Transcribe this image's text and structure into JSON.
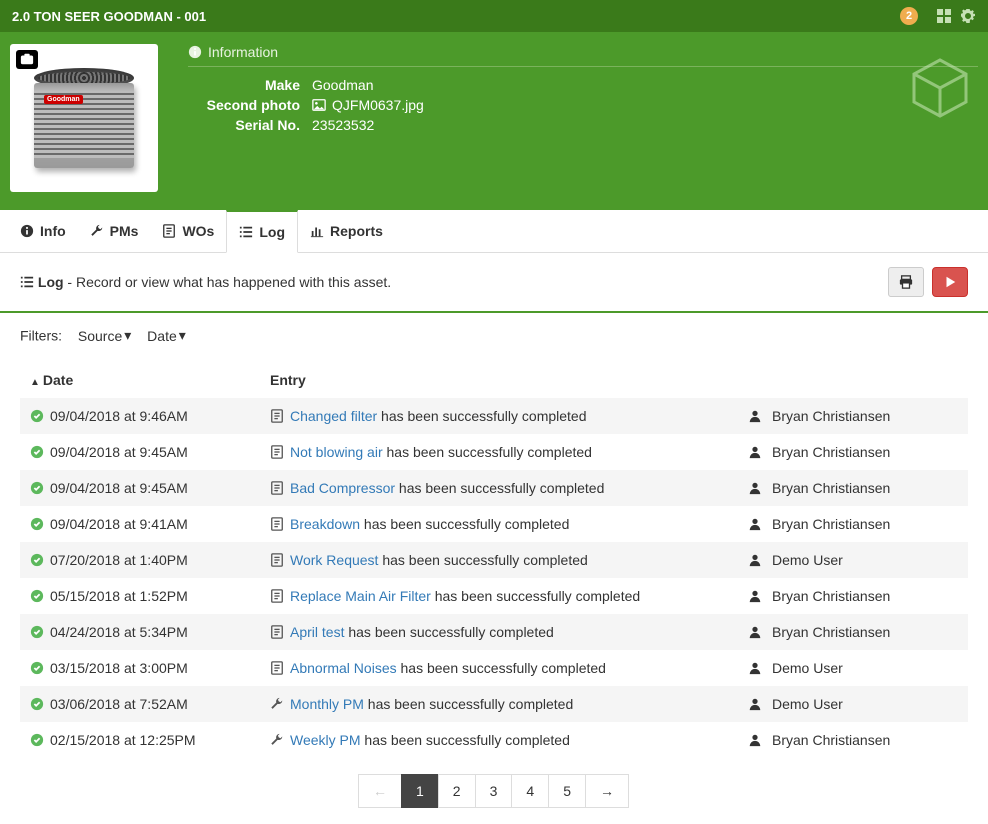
{
  "header": {
    "title": "2.0 TON SEER GOODMAN - 001",
    "notification_count": "2"
  },
  "info": {
    "heading": "Information",
    "make_label": "Make",
    "make_value": "Goodman",
    "photo_label": "Second photo",
    "photo_value": "QJFM0637.jpg",
    "serial_label": "Serial No.",
    "serial_value": "23523532",
    "brand_tag": "Goodman"
  },
  "tabs": {
    "info": "Info",
    "pms": "PMs",
    "wos": "WOs",
    "log": "Log",
    "reports": "Reports"
  },
  "subheader": {
    "title": "Log",
    "desc": " - Record or view what has happened with this asset."
  },
  "filters": {
    "label": "Filters:",
    "source": "Source",
    "date": "Date"
  },
  "columns": {
    "date": "Date",
    "entry": "Entry",
    "user": ""
  },
  "entry_suffix": " has been successfully completed",
  "rows": [
    {
      "date": "09/04/2018 at 9:46AM",
      "icon": "form",
      "link": "Changed filter",
      "user": "Bryan Christiansen"
    },
    {
      "date": "09/04/2018 at 9:45AM",
      "icon": "form",
      "link": "Not blowing air",
      "user": "Bryan Christiansen"
    },
    {
      "date": "09/04/2018 at 9:45AM",
      "icon": "form",
      "link": "Bad Compressor",
      "user": "Bryan Christiansen"
    },
    {
      "date": "09/04/2018 at 9:41AM",
      "icon": "form",
      "link": "Breakdown",
      "user": "Bryan Christiansen"
    },
    {
      "date": "07/20/2018 at 1:40PM",
      "icon": "form",
      "link": "Work Request",
      "user": "Demo User"
    },
    {
      "date": "05/15/2018 at 1:52PM",
      "icon": "form",
      "link": "Replace Main Air Filter",
      "user": "Bryan Christiansen"
    },
    {
      "date": "04/24/2018 at 5:34PM",
      "icon": "form",
      "link": "April test",
      "user": "Bryan Christiansen"
    },
    {
      "date": "03/15/2018 at 3:00PM",
      "icon": "form",
      "link": "Abnormal Noises",
      "user": "Demo User"
    },
    {
      "date": "03/06/2018 at 7:52AM",
      "icon": "wrench",
      "link": "Monthly PM",
      "user": "Demo User"
    },
    {
      "date": "02/15/2018 at 12:25PM",
      "icon": "wrench",
      "link": "Weekly PM",
      "user": "Bryan Christiansen"
    }
  ],
  "pagination": {
    "pages": [
      "1",
      "2",
      "3",
      "4",
      "5"
    ],
    "active": "1"
  }
}
